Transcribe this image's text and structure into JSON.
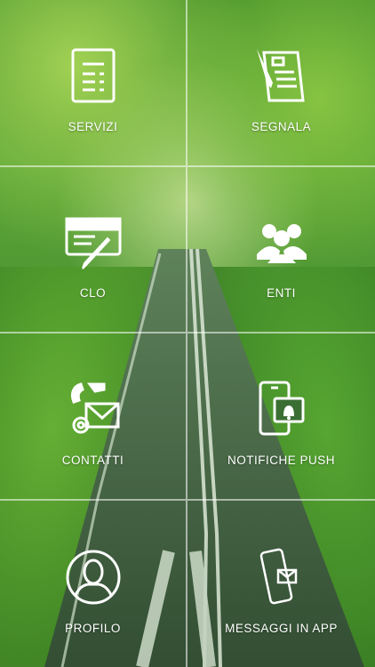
{
  "menu": {
    "tiles": [
      {
        "label": "SERVIZI",
        "icon": "document-list-icon"
      },
      {
        "label": "SEGNALA",
        "icon": "report-pen-icon"
      },
      {
        "label": "CLO",
        "icon": "card-pen-icon"
      },
      {
        "label": "ENTI",
        "icon": "people-group-icon"
      },
      {
        "label": "CONTATTI",
        "icon": "phone-mail-icon"
      },
      {
        "label": "NOTIFICHE PUSH",
        "icon": "phone-bell-icon"
      },
      {
        "label": "PROFILO",
        "icon": "user-circle-icon"
      },
      {
        "label": "MESSAGGI IN APP",
        "icon": "phone-envelope-icon"
      }
    ]
  },
  "colors": {
    "accent": "#ffffff",
    "background": "#4f9a2e"
  }
}
